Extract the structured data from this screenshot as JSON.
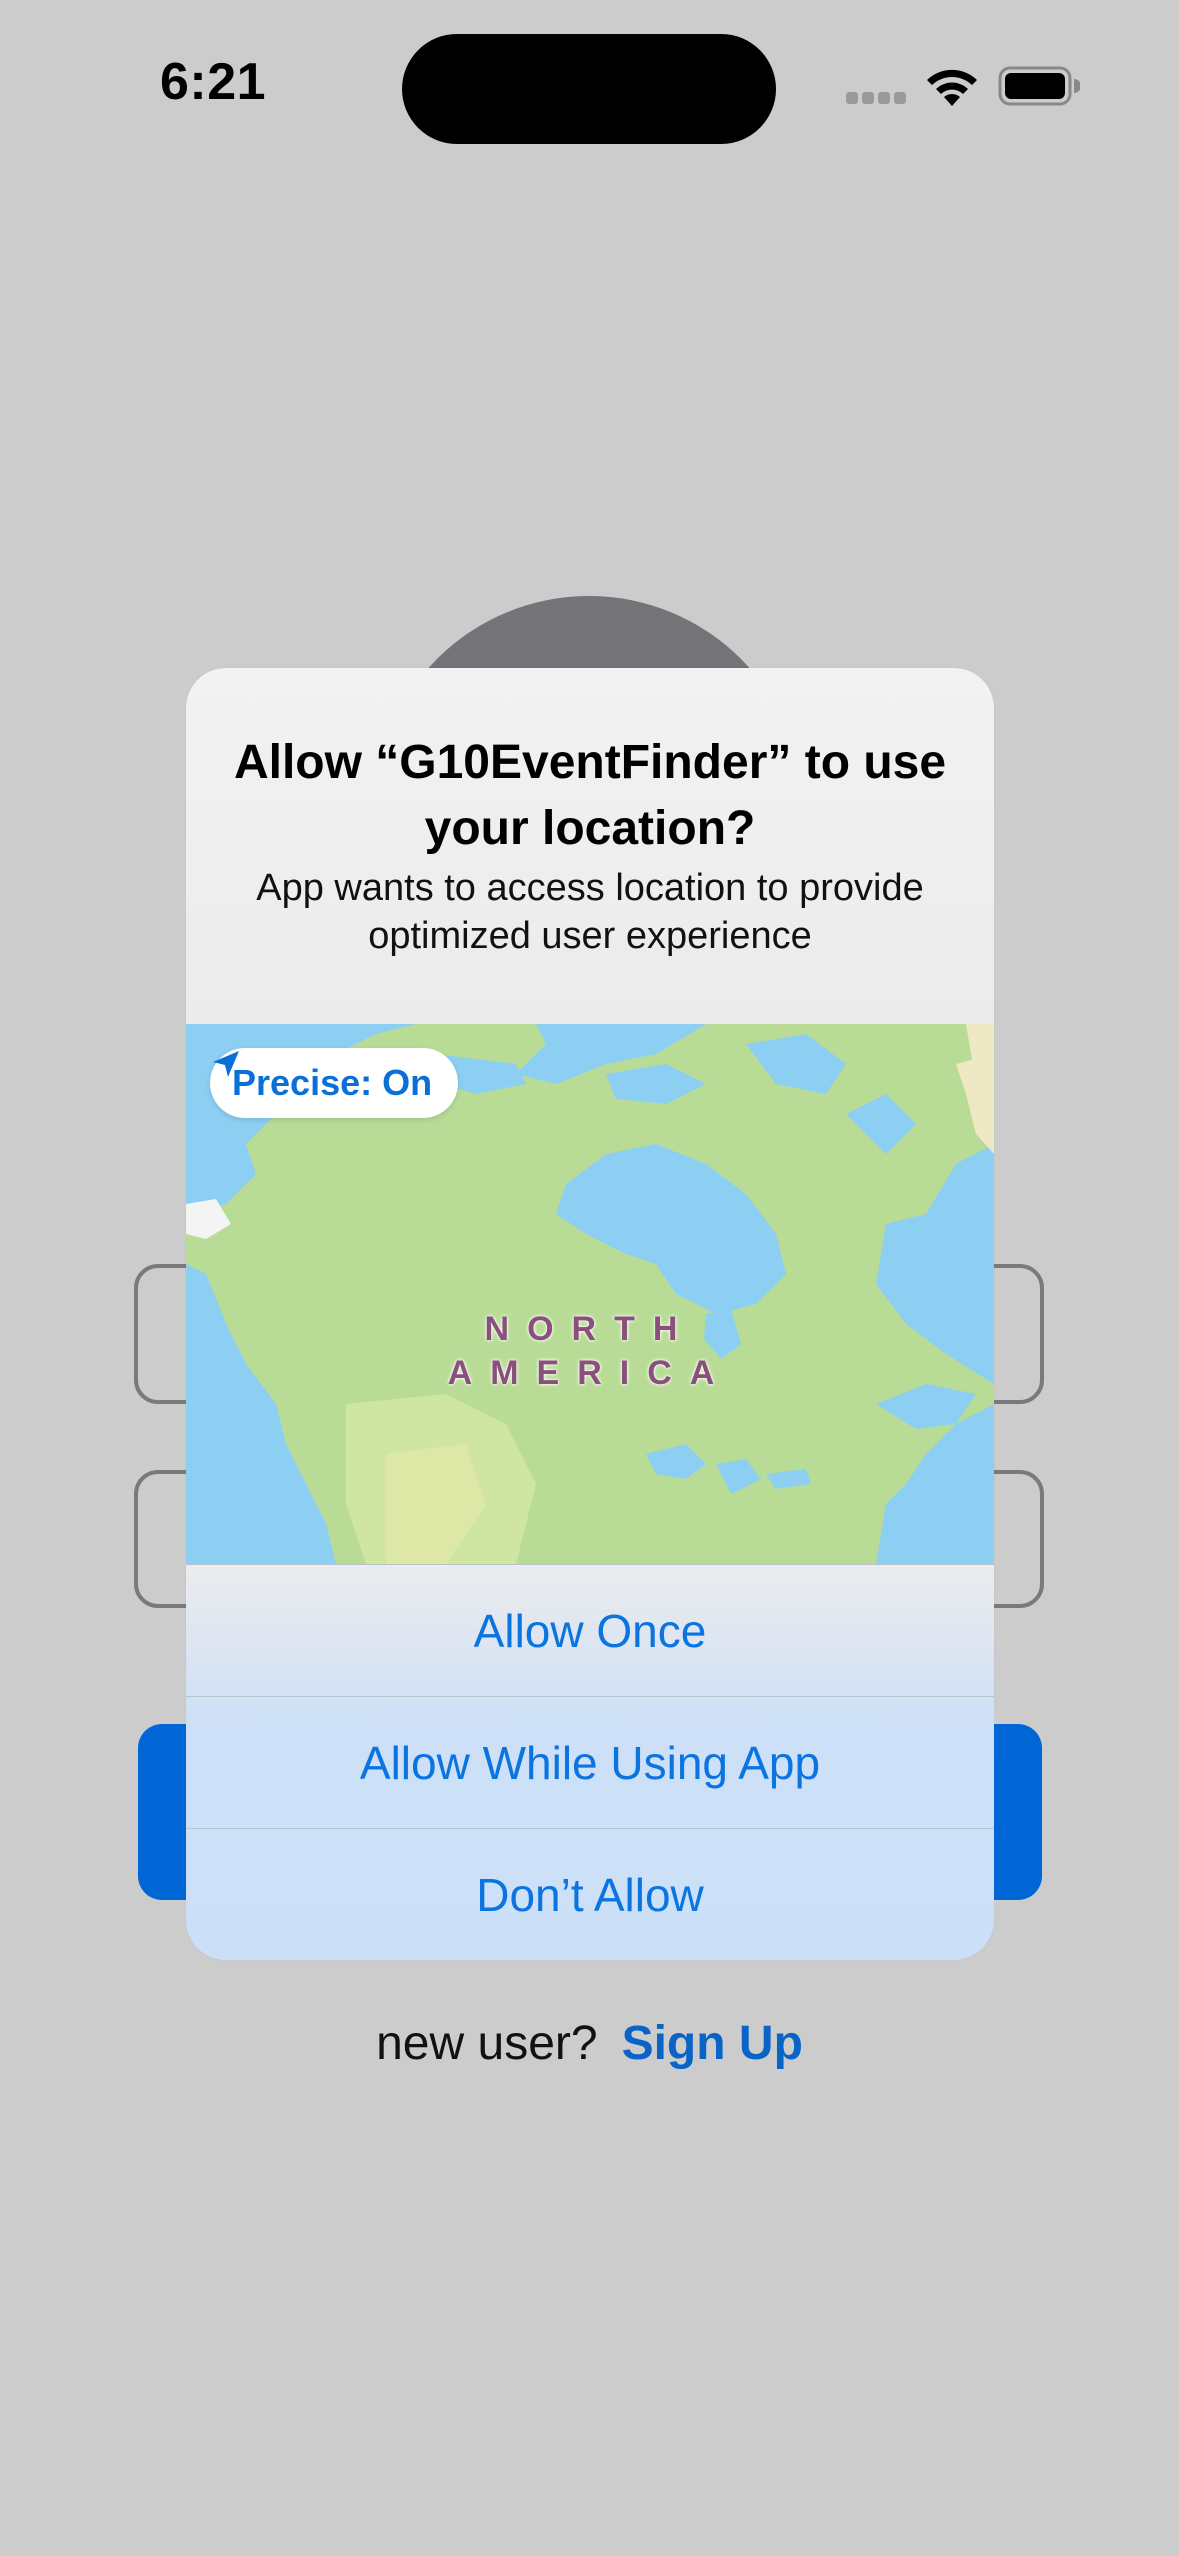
{
  "status_bar": {
    "time": "6:21"
  },
  "background": {
    "signup_prompt": "new user?",
    "signup_link": "Sign Up"
  },
  "alert": {
    "title": "Allow “G10EventFinder” to use your location?",
    "message": "App wants to access location to provide optimized user experience",
    "map": {
      "precise_label": "Precise: On",
      "region_label_line1": "NORTH",
      "region_label_line2": "AMERICA"
    },
    "actions": {
      "allow_once": "Allow Once",
      "allow_while_using": "Allow While Using App",
      "dont_allow": "Don’t Allow"
    }
  },
  "colors": {
    "background": "#cccccc",
    "accent_blue": "#0a74e0",
    "login_button": "#0066d6",
    "map_water": "#8ccff2",
    "map_land": "#b8dc96"
  }
}
